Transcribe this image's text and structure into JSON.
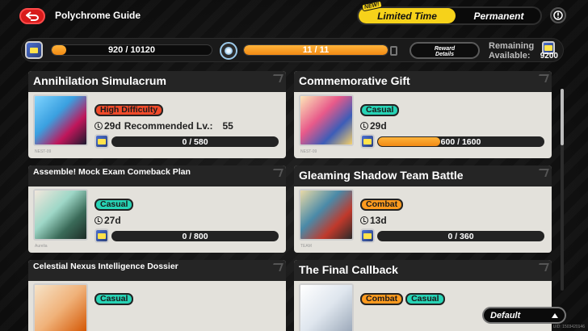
{
  "header": {
    "title": "Polychrome Guide",
    "tabs": {
      "new_badge": "NEW!",
      "limited": "Limited Time",
      "permanent": "Permanent"
    }
  },
  "stats": {
    "film_progress_text": "920 / 10120",
    "film_progress": 0.091,
    "level_progress_text": "11 / 11",
    "level_progress": 1.0,
    "reward_details": "Reward\nDetails",
    "remaining_label": "Remaining Available:",
    "remaining_value": "9200"
  },
  "cards": [
    {
      "title": "Annihilation Simulacrum",
      "tags": [
        "High Difficulty"
      ],
      "days": "29d",
      "recommended_label": "Recommended Lv.:",
      "recommended_value": "55",
      "progress_text": "0 / 580",
      "progress": 0,
      "stamp": "NEST-09"
    },
    {
      "title": "Commemorative Gift",
      "tags": [
        "Casual"
      ],
      "days": "29d",
      "progress_text": "600 / 1600",
      "progress": 0.375,
      "stamp": "NEST-09"
    },
    {
      "title": "Assemble! Mock Exam Comeback Plan",
      "tags": [
        "Casual"
      ],
      "days": "27d",
      "progress_text": "0 / 800",
      "progress": 0,
      "stamp": "Aurelia"
    },
    {
      "title": "Gleaming Shadow Team Battle",
      "tags": [
        "Combat"
      ],
      "days": "13d",
      "progress_text": "0 / 360",
      "progress": 0,
      "stamp": "TEAM"
    },
    {
      "title": "Celestial Nexus Intelligence Dossier",
      "tags": [
        "Casual"
      ],
      "days": "",
      "progress_text": "",
      "progress": 0,
      "stamp": ""
    },
    {
      "title": "The Final Callback",
      "tags": [
        "Combat",
        "Casual"
      ],
      "days": "",
      "progress_text": "",
      "progress": 0,
      "stamp": ""
    }
  ],
  "footer": {
    "sort_label": "Default",
    "uid": "UID: 1503420146"
  },
  "colors": {
    "accent_yellow": "#f6d21a",
    "progress_orange": "#f18a14",
    "tag_high_difficulty": "#f04a2a",
    "tag_casual": "#27d3b5",
    "tag_combat": "#ff9a1e"
  },
  "icons": [
    "back-arrow-icon",
    "help-icon",
    "film-icon",
    "level-gem-icon",
    "clock-icon",
    "sort-arrow-icon"
  ]
}
